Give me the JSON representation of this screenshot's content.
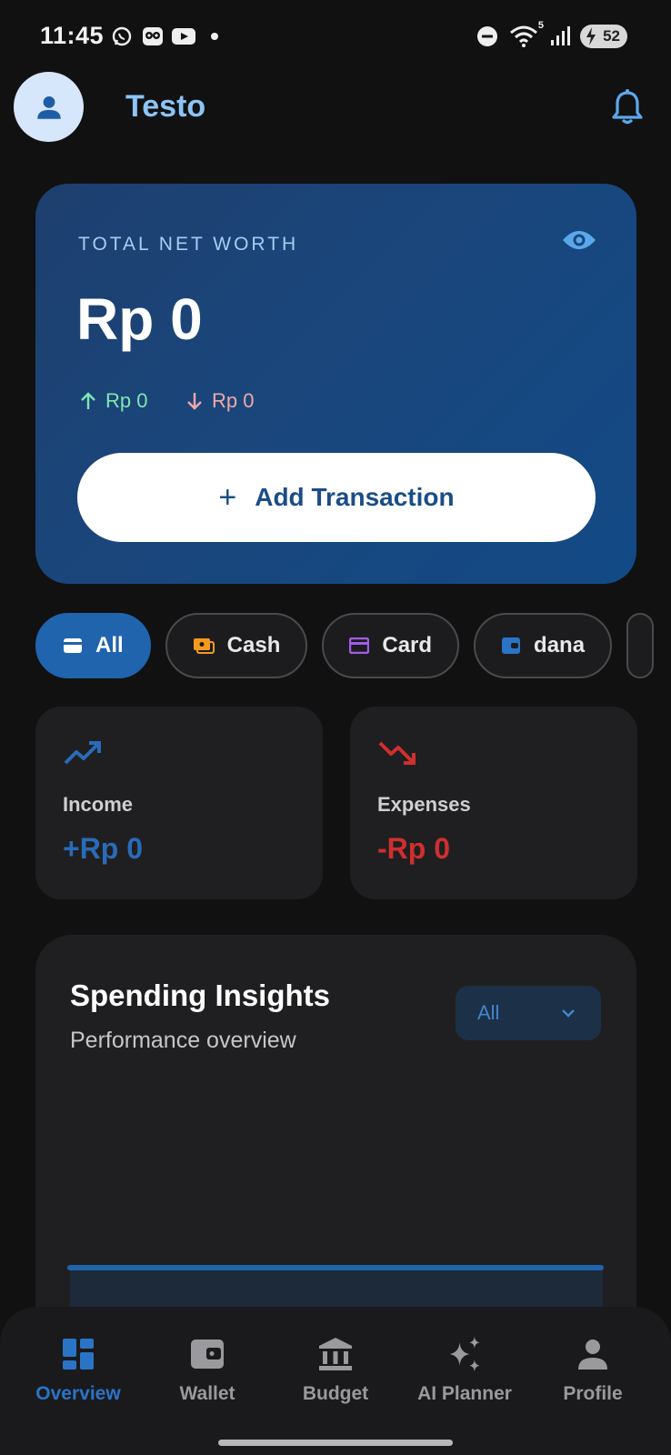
{
  "status_bar": {
    "time": "11:45",
    "left_icons": [
      "whatsapp-icon",
      "owl-app-icon",
      "youtube-icon",
      "notification-dot"
    ],
    "right_icons": [
      "do-not-disturb-icon",
      "wifi-icon",
      "signal-icon"
    ],
    "wifi_label": "5",
    "battery": "52"
  },
  "header": {
    "username": "Testo",
    "avatar_icon": "person-icon",
    "notification_icon": "bell-icon"
  },
  "net_worth": {
    "label": "TOTAL NET WORTH",
    "value": "Rp 0",
    "income": "Rp 0",
    "expense": "Rp 0",
    "add_button": "Add Transaction",
    "add_icon": "+"
  },
  "wallets": [
    {
      "label": "All",
      "color": "#ffffff",
      "active": true
    },
    {
      "label": "Cash",
      "color": "#f39a1e",
      "active": false
    },
    {
      "label": "Card",
      "color": "#a35ce8",
      "active": false
    },
    {
      "label": "dana",
      "color": "#2a74c6",
      "active": false
    }
  ],
  "stats": {
    "income_label": "Income",
    "income_value": "+Rp 0",
    "income_color": "#2a6bb8",
    "expenses_label": "Expenses",
    "expenses_value": "-Rp 0",
    "expenses_color": "#cf2f2f"
  },
  "insights": {
    "title": "Spending Insights",
    "subtitle": "Performance overview",
    "filter_value": "All"
  },
  "nav": [
    {
      "label": "Overview",
      "icon": "dashboard-icon",
      "active": true
    },
    {
      "label": "Wallet",
      "icon": "wallet-icon",
      "active": false
    },
    {
      "label": "Budget",
      "icon": "bank-icon",
      "active": false
    },
    {
      "label": "AI Planner",
      "icon": "sparkles-icon",
      "active": false
    },
    {
      "label": "Profile",
      "icon": "person-icon",
      "active": false
    }
  ],
  "colors": {
    "accent": "#1f64ad",
    "background": "#111112",
    "card": "#1f1f21"
  }
}
